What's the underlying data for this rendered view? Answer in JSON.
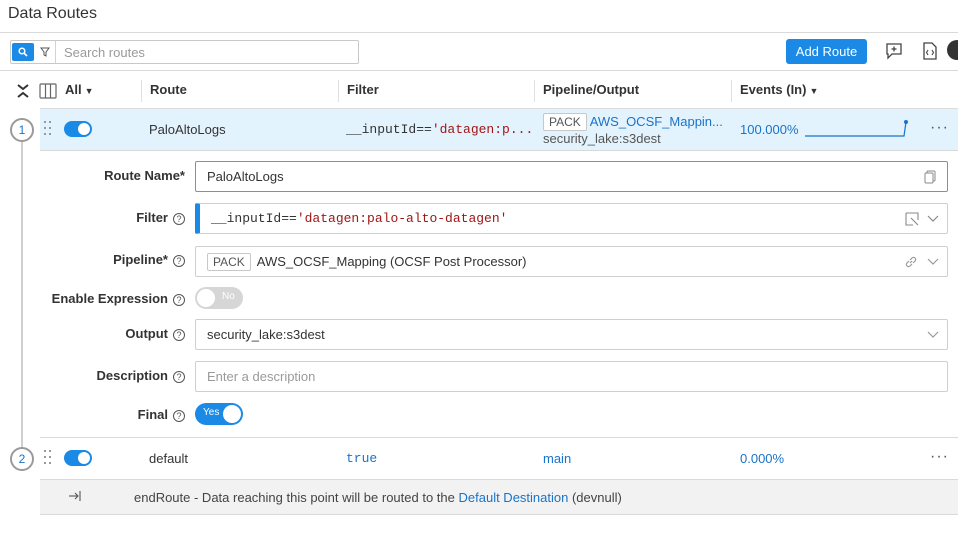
{
  "page": {
    "title": "Data Routes"
  },
  "toolbar": {
    "search_placeholder": "Search routes",
    "add_route_label": "Add Route"
  },
  "table_header": {
    "all_label": "All",
    "route": "Route",
    "filter": "Filter",
    "pipeline_output": "Pipeline/Output",
    "events_in": "Events (In)"
  },
  "routes": [
    {
      "step": "1",
      "name": "PaloAltoLogs",
      "filter_prefix": "__inputId==",
      "filter_str_truncated": "'datagen:p...",
      "pack_badge": "PACK",
      "pipeline_truncated": "AWS_OCSF_Mappin...",
      "output": "security_lake:s3dest",
      "events_pct": "100.000%",
      "enabled": true
    },
    {
      "step": "2",
      "name": "default",
      "filter": "true",
      "pipeline": "main",
      "events_pct": "0.000%",
      "enabled": true
    }
  ],
  "form": {
    "route_name_label": "Route Name*",
    "route_name_value": "PaloAltoLogs",
    "filter_label": "Filter",
    "filter_prefix": "__inputId==",
    "filter_str": "'datagen:palo-alto-datagen'",
    "pipeline_label": "Pipeline*",
    "pipeline_pack": "PACK",
    "pipeline_value": "AWS_OCSF_Mapping (OCSF Post Processor)",
    "enable_expression_label": "Enable Expression",
    "enable_expression_state": "No",
    "output_label": "Output",
    "output_value": "security_lake:s3dest",
    "description_label": "Description",
    "description_placeholder": "Enter a description",
    "final_label": "Final",
    "final_state": "Yes",
    "help_glyph": "?"
  },
  "end_route": {
    "prefix": "endRoute - Data reaching this point will be routed to the",
    "link": "Default Destination",
    "suffix": "(devnull)"
  },
  "colors": {
    "accent": "#1a8ae6",
    "row_highlight": "#e3f3fd",
    "string": "#a31515",
    "link": "#1a73c9"
  }
}
